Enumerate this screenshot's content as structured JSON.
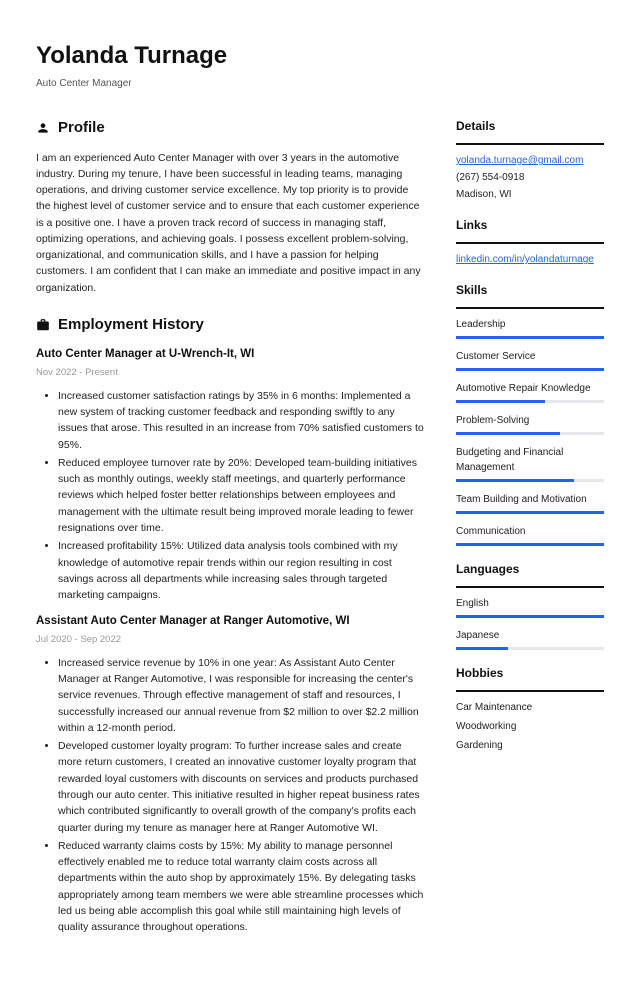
{
  "header": {
    "name": "Yolanda Turnage",
    "title": "Auto Center Manager"
  },
  "profile": {
    "heading": "Profile",
    "text": "I am an experienced Auto Center Manager with over 3 years in the automotive industry. During my tenure, I have been successful in leading teams, managing operations, and driving customer service excellence. My top priority is to provide the highest level of customer service and to ensure that each customer experience is a positive one. I have a proven track record of success in managing staff, optimizing operations, and achieving goals. I possess excellent problem-solving, organizational, and communication skills, and I have a passion for helping customers. I am confident that I can make an immediate and positive impact in any organization."
  },
  "employment": {
    "heading": "Employment History",
    "jobs": [
      {
        "title": "Auto Center Manager at U-Wrench-It, WI",
        "dates": "Nov 2022 - Present",
        "bullets": [
          "Increased customer satisfaction ratings by 35% in 6 months: Implemented a new system of tracking customer feedback and responding swiftly to any issues that arose. This resulted in an increase from 70% satisfied customers to 95%.",
          "Reduced employee turnover rate by 20%: Developed team-building initiatives such as monthly outings, weekly staff meetings, and quarterly performance reviews which helped foster better relationships between employees and management with the ultimate result being improved morale leading to fewer resignations over time.",
          "Increased profitability 15%: Utilized data analysis tools combined with my knowledge of automotive repair trends within our region resulting in cost savings across all departments while increasing sales through targeted marketing campaigns."
        ]
      },
      {
        "title": "Assistant Auto Center Manager at Ranger Automotive, WI",
        "dates": "Jul 2020 - Sep 2022",
        "bullets": [
          "Increased service revenue by 10% in one year: As Assistant Auto Center Manager at Ranger Automotive, I was responsible for increasing the center's service revenues. Through effective management of staff and resources, I successfully increased our annual revenue from $2 million to over $2.2 million within a 12-month period.",
          "Developed customer loyalty program: To further increase sales and create more return customers, I created an innovative customer loyalty program that rewarded loyal customers with discounts on services and products purchased through our auto center. This initiative resulted in higher repeat business rates which contributed significantly to overall growth of the company's profits each quarter during my tenure as manager here at Ranger Automotive WI.",
          "Reduced warranty claims costs by 15%: My ability to manage personnel effectively enabled me to reduce total warranty claim costs across all departments within the auto shop by approximately 15%. By delegating tasks appropriately among team members we were able streamline processes which led us being able accomplish this goal while still maintaining high levels of quality assurance throughout operations."
        ]
      }
    ]
  },
  "details": {
    "heading": "Details",
    "email": "yolanda.turnage@gmail.com",
    "phone": "(267) 554-0918",
    "location": "Madison, WI"
  },
  "links": {
    "heading": "Links",
    "items": [
      "linkedin.com/in/yolandaturnage"
    ]
  },
  "skills": {
    "heading": "Skills",
    "items": [
      {
        "name": "Leadership",
        "level": 100
      },
      {
        "name": "Customer Service",
        "level": 100
      },
      {
        "name": "Automotive Repair Knowledge",
        "level": 60
      },
      {
        "name": "Problem-Solving",
        "level": 70
      },
      {
        "name": "Budgeting and Financial Management",
        "level": 80
      },
      {
        "name": "Team Building and Motivation",
        "level": 100
      },
      {
        "name": "Communication",
        "level": 100
      }
    ]
  },
  "languages": {
    "heading": "Languages",
    "items": [
      {
        "name": "English",
        "level": 100
      },
      {
        "name": "Japanese",
        "level": 35
      }
    ]
  },
  "hobbies": {
    "heading": "Hobbies",
    "items": [
      "Car Maintenance",
      "Woodworking",
      "Gardening"
    ]
  }
}
